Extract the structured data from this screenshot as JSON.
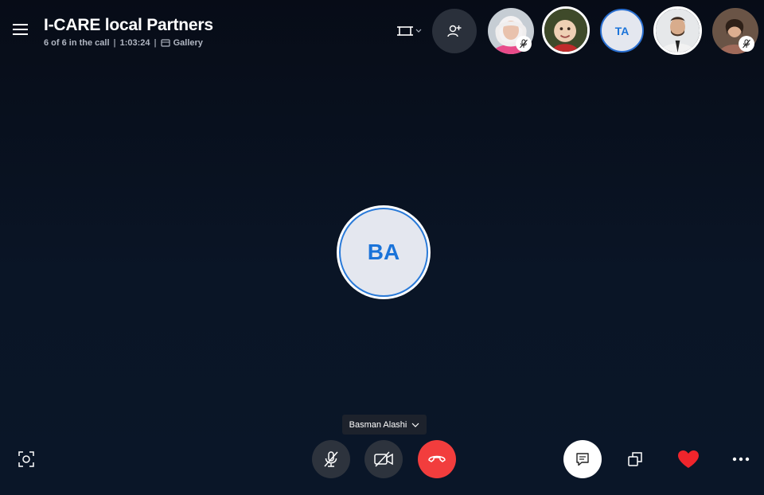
{
  "header": {
    "title": "I-CARE local Partners",
    "participants": "6 of 6 in the call",
    "separator": "|",
    "duration": "1:03:24",
    "view_mode": "Gallery"
  },
  "participants": {
    "ta_initials": "TA"
  },
  "main": {
    "speaker_initials": "BA",
    "speaker_name": "Basman Alashi"
  },
  "colors": {
    "accent": "#1a73d9",
    "end_call": "#f23d3d",
    "heart": "#f0252c",
    "background": "#0a1526"
  },
  "icons": {
    "menu": "hamburger-icon",
    "layout": "layout-icon",
    "add_participant": "add-person-icon",
    "mute": "mic-off-icon",
    "video": "video-off-icon",
    "end": "phone-hangup-icon",
    "chat": "chat-icon",
    "share": "share-screen-icon",
    "react": "heart-icon",
    "more": "more-icon",
    "snapshot": "camera-capture-icon"
  }
}
